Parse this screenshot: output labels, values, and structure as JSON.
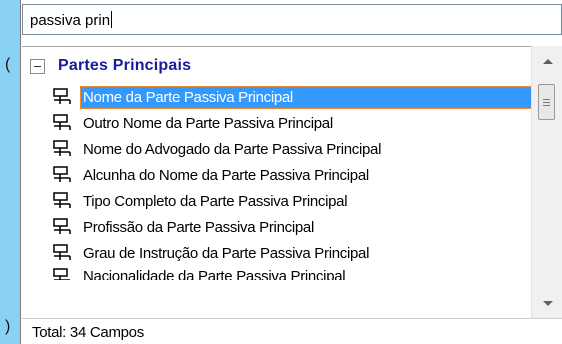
{
  "search": {
    "value": "passiva prin"
  },
  "list": {
    "group_title": "Partes Principais",
    "items": [
      {
        "label": "Nome da Parte Passiva Principal",
        "selected": true
      },
      {
        "label": "Outro Nome da Parte Passiva Principal"
      },
      {
        "label": "Nome do Advogado da Parte Passiva Principal"
      },
      {
        "label": "Alcunha do Nome da Parte Passiva Principal"
      },
      {
        "label": "Tipo Completo da Parte Passiva Principal"
      },
      {
        "label": "Profissão da Parte Passiva Principal"
      },
      {
        "label": "Grau de Instrução da Parte Passiva Principal"
      },
      {
        "label": "Nacionalidade da Parte Passiva Principal"
      }
    ]
  },
  "footer": {
    "total": "Total: 34 Campos"
  },
  "icons": {
    "expander": "collapse-box-icon",
    "field": "field-network-icon",
    "scroll_up": "triangle-up-icon",
    "scroll_down": "triangle-down-icon"
  },
  "colors": {
    "background": "#8ad2f4",
    "group_title": "#1b1ba0",
    "selection": "#3399ff",
    "selection_outline": "#f08a2a"
  }
}
